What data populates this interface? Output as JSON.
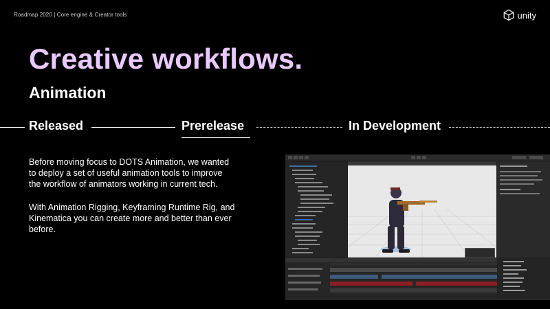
{
  "header": {
    "breadcrumb": "Roadmap 2020 | Core engine & Creator tools",
    "logo_text": "unity"
  },
  "title": "Creative workflows.",
  "subtitle": "Animation",
  "timeline": {
    "stages": [
      "Released",
      "Prerelease",
      "In Development"
    ],
    "current_stage": "Prerelease"
  },
  "body": {
    "paragraph_1": "Before moving focus to DOTS Animation, we wanted to deploy a set of useful animation tools to improve the workflow of animators working in current tech.",
    "paragraph_2": "With Animation Rigging, Keyframing Runtime Rig, and Kinematica you can create more and better than ever before."
  },
  "colors": {
    "background": "#000000",
    "title": "#e9c9ff",
    "text": "#ffffff",
    "track_red": "#8a1f24",
    "track_blue": "#3d5a7a",
    "selection_blue": "#3f6ea0"
  },
  "screenshot": {
    "description_icon": "unity-editor-screenshot"
  }
}
